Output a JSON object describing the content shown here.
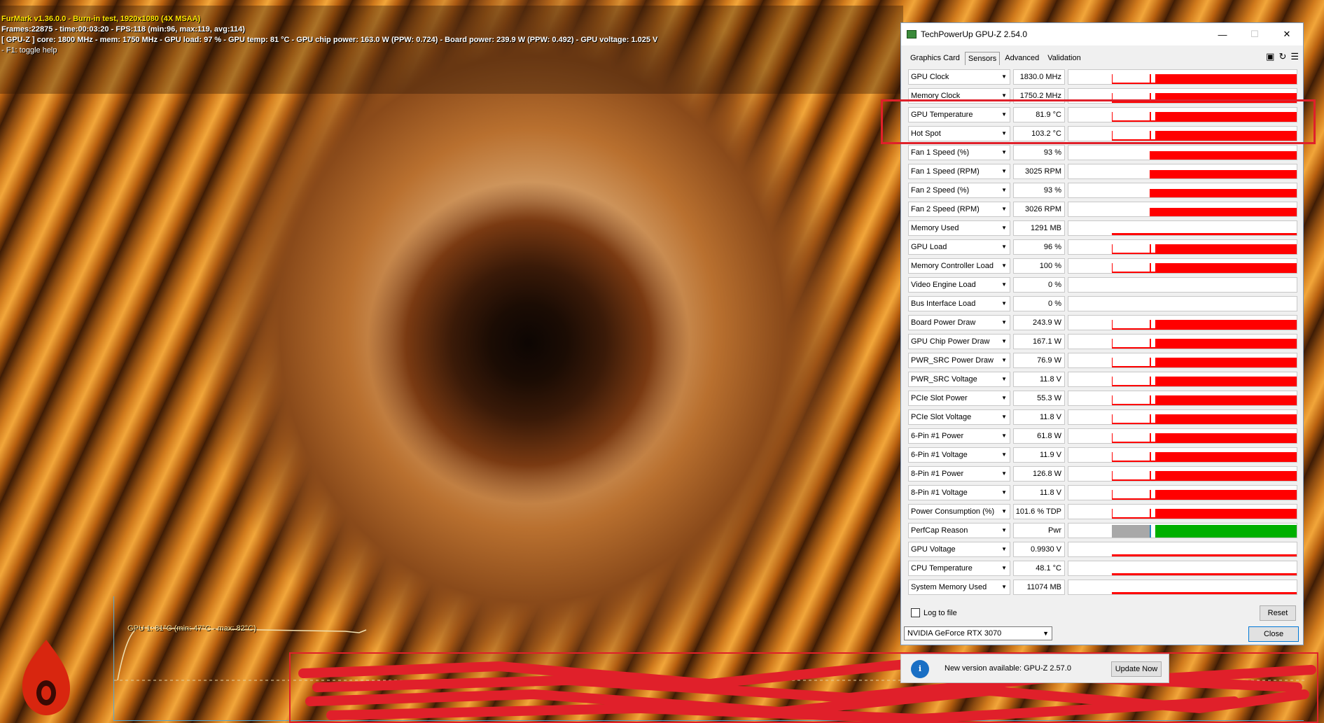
{
  "furmark": {
    "title_line": "FurMark v1.36.0.0 - Burn-in test, 1920x1080 (4X MSAA)",
    "frames_line": "Frames:22875 - time:00:03:20 - FPS:118 (min:96, max:119, avg:114)",
    "gpuz_line": "[ GPU-Z ] core: 1800 MHz - mem: 1750 MHz - GPU load: 97 % - GPU temp: 81 °C - GPU chip power: 163.0 W (PPW: 0.724) - Board power: 239.9 W (PPW: 0.492) - GPU voltage: 1.025 V",
    "help_line": "- F1: toggle help",
    "graph_label": "GPU 1: 81°C (min: 47°C - max: 82°C)"
  },
  "gpuz": {
    "title": "TechPowerUp GPU-Z 2.54.0",
    "tabs": [
      "Graphics Card",
      "Sensors",
      "Advanced",
      "Validation"
    ],
    "active_tab": "Sensors",
    "toolbar_icons": [
      "camera-icon",
      "refresh-icon",
      "menu-icon"
    ],
    "sensors": [
      {
        "name": "GPU Clock",
        "value": "1830.0 MHz"
      },
      {
        "name": "Memory Clock",
        "value": "1750.2 MHz"
      },
      {
        "name": "GPU Temperature",
        "value": "81.9 °C"
      },
      {
        "name": "Hot Spot",
        "value": "103.2 °C"
      },
      {
        "name": "Fan 1 Speed (%)",
        "value": "93 %"
      },
      {
        "name": "Fan 1 Speed (RPM)",
        "value": "3025 RPM"
      },
      {
        "name": "Fan 2 Speed (%)",
        "value": "93 %"
      },
      {
        "name": "Fan 2 Speed (RPM)",
        "value": "3026 RPM"
      },
      {
        "name": "Memory Used",
        "value": "1291 MB"
      },
      {
        "name": "GPU Load",
        "value": "96 %"
      },
      {
        "name": "Memory Controller Load",
        "value": "100 %"
      },
      {
        "name": "Video Engine Load",
        "value": "0 %"
      },
      {
        "name": "Bus Interface Load",
        "value": "0 %"
      },
      {
        "name": "Board Power Draw",
        "value": "243.9 W"
      },
      {
        "name": "GPU Chip Power Draw",
        "value": "167.1 W"
      },
      {
        "name": "PWR_SRC Power Draw",
        "value": "76.9 W"
      },
      {
        "name": "PWR_SRC Voltage",
        "value": "11.8 V"
      },
      {
        "name": "PCIe Slot Power",
        "value": "55.3 W"
      },
      {
        "name": "PCIe Slot Voltage",
        "value": "11.8 V"
      },
      {
        "name": "6-Pin #1 Power",
        "value": "61.8 W"
      },
      {
        "name": "6-Pin #1 Voltage",
        "value": "11.9 V"
      },
      {
        "name": "8-Pin #1 Power",
        "value": "126.8 W"
      },
      {
        "name": "8-Pin #1 Voltage",
        "value": "11.8 V"
      },
      {
        "name": "Power Consumption (%)",
        "value": "101.6 % TDP"
      },
      {
        "name": "PerfCap Reason",
        "value": "Pwr"
      },
      {
        "name": "GPU Voltage",
        "value": "0.9930 V"
      },
      {
        "name": "CPU Temperature",
        "value": "48.1 °C"
      },
      {
        "name": "System Memory Used",
        "value": "11074 MB"
      }
    ],
    "log_to_file": "Log to file",
    "reset": "Reset",
    "gpu_select": "NVIDIA GeForce RTX 3070",
    "close": "Close",
    "colors": {
      "graph": "#ff0000",
      "perfcap_idle": "#a8a8a8",
      "perfcap_power": "#00b000"
    }
  },
  "notification": {
    "message": "New version available: GPU-Z 2.57.0",
    "button": "Update Now"
  }
}
